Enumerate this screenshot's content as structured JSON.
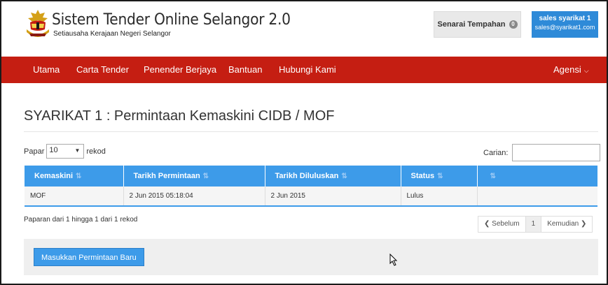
{
  "header": {
    "title": "Sistem Tender Online Selangor 2.0",
    "subtitle": "Setiausaha Kerajaan Negeri Selangor",
    "cart_label": "Senarai Tempahan",
    "cart_count": "0",
    "user_name": "sales syarikat 1",
    "user_email": "sales@syarikat1.com"
  },
  "nav": {
    "items": [
      "Utama",
      "Carta Tender",
      "Penender Berjaya",
      "Bantuan",
      "Hubungi Kami"
    ],
    "agency": "Agensi",
    "bg_color": "#c51e12"
  },
  "page": {
    "title": "SYARIKAT 1 : Permintaan Kemaskini CIDB / MOF"
  },
  "table_controls": {
    "show_prefix": "Papar",
    "page_length": "10",
    "show_suffix": "rekod",
    "search_label": "Carian:",
    "search_value": ""
  },
  "table": {
    "columns": [
      "Kemaskini",
      "Tarikh Permintaan",
      "Tarikh Diluluskan",
      "Status",
      ""
    ],
    "rows": [
      [
        "MOF",
        "2 Jun 2015 05:18:04",
        "2 Jun 2015",
        "Lulus",
        ""
      ]
    ],
    "header_color": "#3d9be9"
  },
  "info_text": "Paparan dari 1 hingga 1 dari 1 rekod",
  "pagination": {
    "prev": "Sebelum",
    "current": "1",
    "next": "Kemudian"
  },
  "actions": {
    "new_request": "Masukkan Permintaan Baru"
  },
  "icons": [
    "crest-logo-icon",
    "sort-icon",
    "chevron-down-icon",
    "chevron-left-icon",
    "chevron-right-icon",
    "mouse-cursor-icon"
  ]
}
